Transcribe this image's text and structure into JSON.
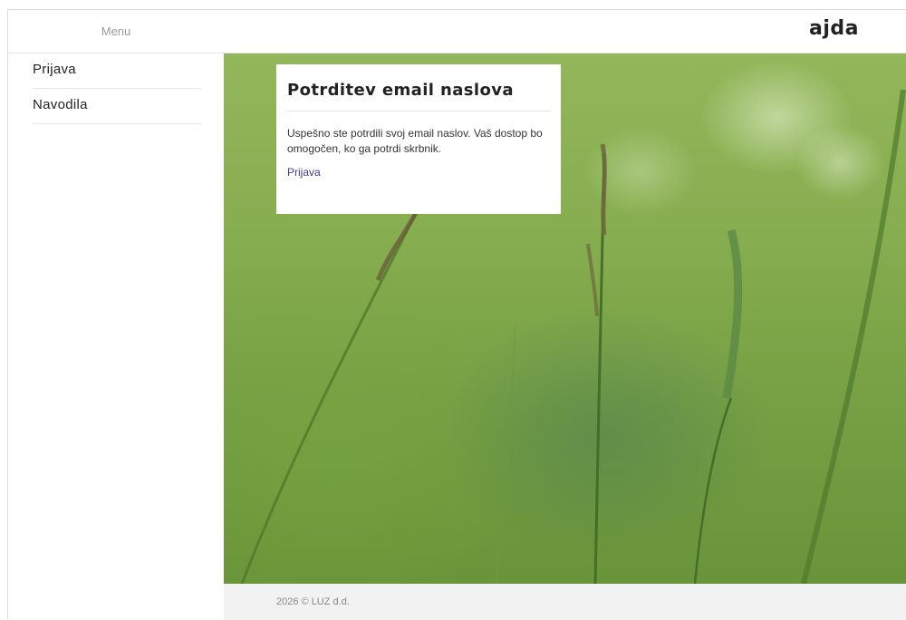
{
  "header": {
    "menu_label": "Menu",
    "logo": "ajda"
  },
  "sidebar": {
    "items": [
      {
        "label": "Prijava"
      },
      {
        "label": "Navodila"
      }
    ]
  },
  "card": {
    "title": "Potrditev email naslova",
    "message": "Uspešno ste potrdili svoj email naslov. Vaš dostop bo omogočen, ko ga potrdi skrbnik.",
    "link_label": "Prijava"
  },
  "footer": {
    "text": "2026 © LUZ d.d."
  },
  "colors": {
    "link": "#3b3b8f",
    "hero_green": "#86ad4f",
    "footer_bg": "#f2f2f2"
  }
}
